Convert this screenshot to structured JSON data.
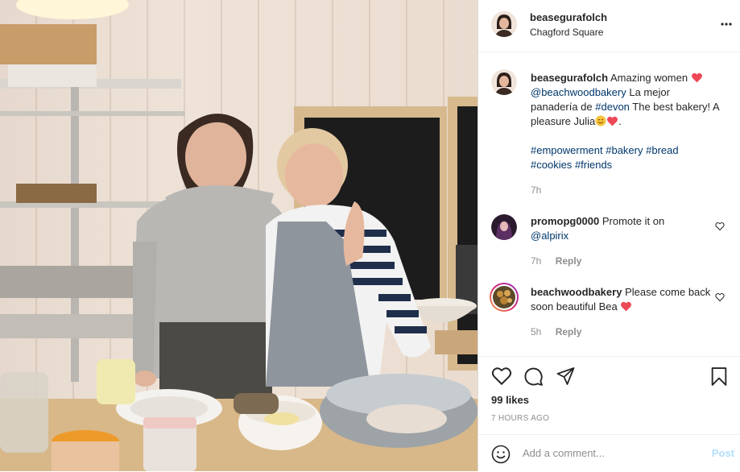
{
  "post": {
    "author": "beasegurafolch",
    "location": "Chagford Square",
    "caption": {
      "username": "beasegurafolch",
      "text_1": "Amazing women",
      "mention_bakery": "@beachwoodbakery",
      "text_2": "La mejor panadería de",
      "hashtag_devon": "#devon",
      "text_3": "The best bakery! A pleasure Julia",
      "tags": [
        "#empowerment",
        "#bakery",
        "#bread",
        "#cookies",
        "#friends"
      ],
      "time": "7h"
    },
    "comments": [
      {
        "username": "promopg0000",
        "text": "Promote it on",
        "mention": "@alpirix",
        "time": "7h",
        "reply": "Reply"
      },
      {
        "username": "beachwoodbakery",
        "text": "Please come back soon beautiful Bea",
        "time": "5h",
        "reply": "Reply"
      }
    ],
    "likes": "99 likes",
    "time_ago": "7 HOURS AGO",
    "add_comment_placeholder": "Add a comment...",
    "post_button": "Post"
  },
  "colors": {
    "heart_red": "#ed4956",
    "link_blue": "#00376b",
    "muted": "#8e8e8e",
    "post_disabled": "#b2dffc"
  },
  "icons": [
    "more-icon",
    "heart-icon",
    "comment-icon",
    "share-icon",
    "bookmark-icon",
    "emoji-icon"
  ]
}
